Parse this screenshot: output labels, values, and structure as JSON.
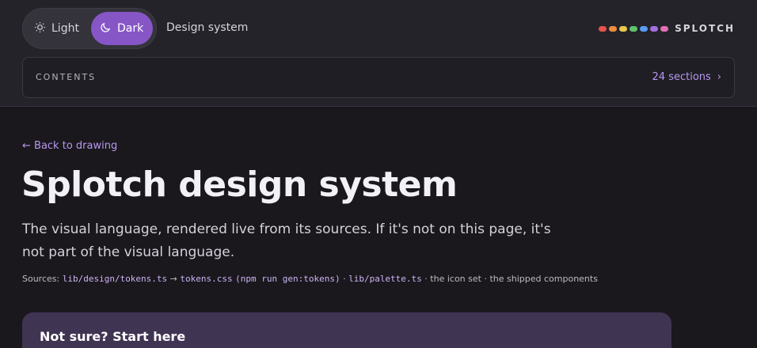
{
  "header": {
    "theme_light_label": "Light",
    "theme_dark_label": "Dark",
    "page_label": "Design system",
    "brand_name": "SPLOTCH",
    "brand_dot_colors": [
      "#e5534b",
      "#ef8a3e",
      "#e6c84a",
      "#5fc36b",
      "#5b9bf0",
      "#a070e0",
      "#e46fb4"
    ]
  },
  "contents": {
    "label": "CONTENTS",
    "sections_count": "24 sections",
    "chevron": "›"
  },
  "main": {
    "back_link": "← Back to drawing",
    "title": "Splotch design system",
    "lede": "The visual language, rendered live from its sources. If it's not on this page, it's not part of the visual language.",
    "sources": {
      "prefix": "Sources:",
      "tokens_ts": "lib/design/tokens.ts",
      "arrow": "→",
      "tokens_css": "tokens.css",
      "gen_cmd": "(npm run gen:tokens)",
      "sep1": "·",
      "palette_ts": "lib/palette.ts",
      "sep2": "·",
      "icon_set": "the icon set",
      "sep3": "·",
      "components": "the shipped components"
    },
    "start_card_title": "Not sure? Start here"
  },
  "colors": {
    "accent": "#8656c6",
    "link": "#b897ef",
    "background": "#1a181d"
  }
}
